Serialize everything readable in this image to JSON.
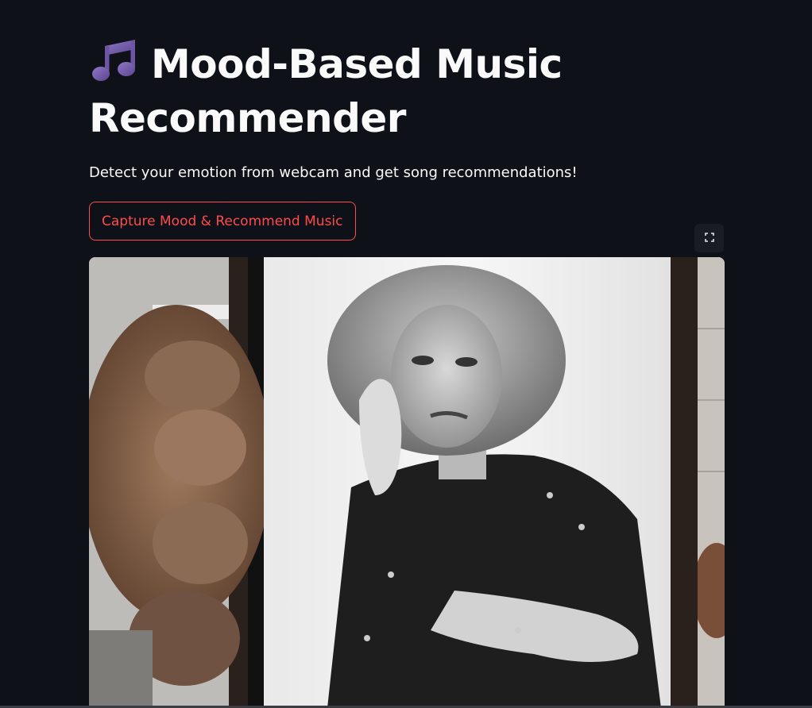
{
  "header": {
    "title": "Mood-Based Music Recommender",
    "title_icon": "music-note-icon",
    "subtitle": "Detect your emotion from webcam and get song recommendations!"
  },
  "actions": {
    "capture_label": "Capture Mood & Recommend Music"
  },
  "webcam": {
    "fullscreen_icon": "fullscreen-icon",
    "image_description_icon": "webcam-snapshot"
  },
  "colors": {
    "background": "#0e1117",
    "text": "#fafafa",
    "accent": "#ff4b4b",
    "icon_purple": "#7b5ea7"
  }
}
